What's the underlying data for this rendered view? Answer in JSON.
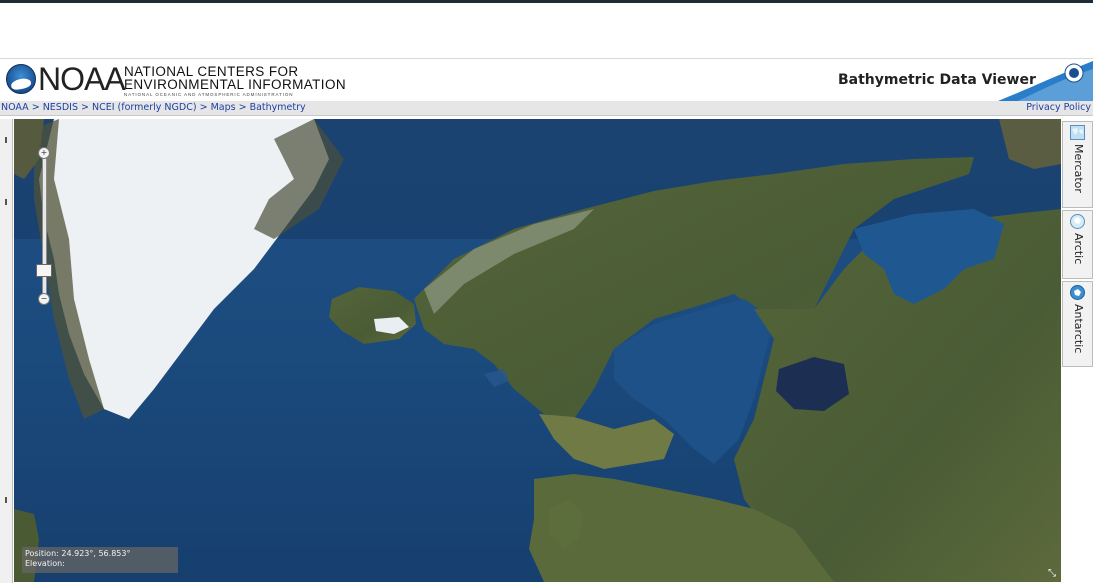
{
  "header": {
    "logo_text": "NOAA",
    "org_line1": "NATIONAL CENTERS FOR",
    "org_line2": "ENVIRONMENTAL INFORMATION",
    "org_line3": "NATIONAL OCEANIC AND ATMOSPHERIC ADMINISTRATION",
    "app_title": "Bathymetric Data Viewer"
  },
  "breadcrumb": {
    "items": [
      "NOAA",
      "NESDIS",
      "NCEI (formerly NGDC)",
      "Maps",
      "Bathymetry"
    ],
    "separator": " > ",
    "privacy": "Privacy Policy"
  },
  "map": {
    "zoom_in": "+",
    "zoom_out": "−",
    "position_label": "Position: 24.923°, 56.853°",
    "elevation_label": "Elevation:"
  },
  "projections": [
    {
      "label": "Mercator",
      "icon": "mercator-map-icon"
    },
    {
      "label": "Arctic",
      "icon": "arctic-globe-icon"
    },
    {
      "label": "Antarctic",
      "icon": "antarctic-globe-icon"
    }
  ],
  "colors": {
    "ocean": "#1b4a7f",
    "land": "#4d5f37",
    "ice": "#eef2f5",
    "link": "#1b3fa6",
    "swoosh": "#2a7dc8"
  }
}
